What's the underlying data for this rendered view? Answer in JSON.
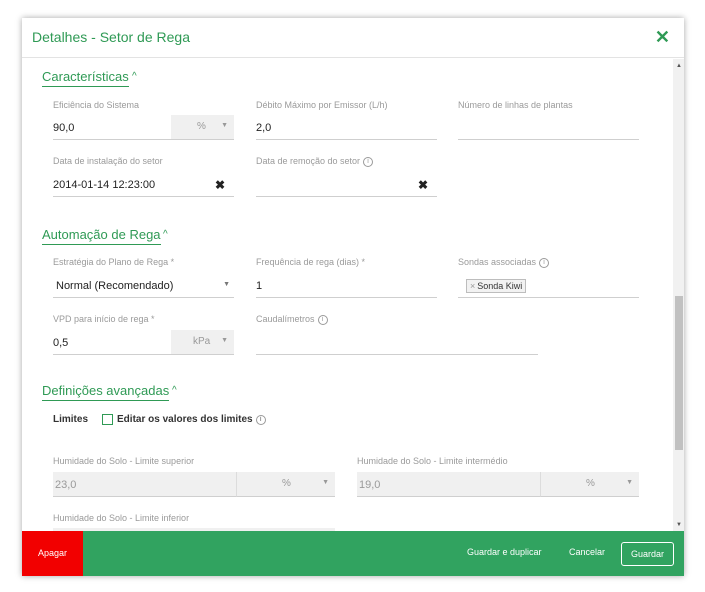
{
  "modal": {
    "title": "Detalhes - Setor de Rega",
    "close_icon": "×"
  },
  "sections": {
    "caracteristicas": {
      "title": "Características",
      "eficiencia": {
        "label": "Eficiência do Sistema",
        "value": "90,0",
        "unit": "%"
      },
      "debito": {
        "label": "Débito Máximo por Emissor (L/h)",
        "value": "2,0"
      },
      "linhas": {
        "label": "Número de linhas de plantas",
        "value": ""
      },
      "instalacao": {
        "label": "Data de instalação do setor",
        "value": "2014-01-14 12:23:00"
      },
      "remocao": {
        "label": "Data de remoção do setor",
        "value": ""
      }
    },
    "automacao": {
      "title": "Automação de Rega",
      "estrategia": {
        "label": "Estratégia do Plano de Rega *",
        "value": "Normal (Recomendado)"
      },
      "frequencia": {
        "label": "Frequência de rega (dias) *",
        "value": "1"
      },
      "sondas": {
        "label": "Sondas associadas",
        "tag": "Sonda Kiwi"
      },
      "vpd": {
        "label": "VPD para início de rega *",
        "value": "0,5",
        "unit": "kPa"
      },
      "caudalimetros": {
        "label": "Caudalímetros",
        "value": ""
      }
    },
    "avancadas": {
      "title": "Definições avançadas",
      "limites_label": "Limites",
      "editar_label": "Editar os valores dos limites",
      "hum_sup": {
        "label": "Humidade do Solo - Limite superior",
        "value": "23,0",
        "unit": "%"
      },
      "hum_int": {
        "label": "Humidade do Solo - Limite intermédio",
        "value": "19,0",
        "unit": "%"
      },
      "hum_inf": {
        "label": "Humidade do Solo - Limite inferior"
      }
    }
  },
  "footer": {
    "delete": "Apagar",
    "save_duplicate": "Guardar e duplicar",
    "cancel": "Cancelar",
    "save": "Guardar"
  },
  "colors": {
    "accent": "#2f9a55",
    "footer": "#31a360",
    "delete": "#f20000"
  }
}
